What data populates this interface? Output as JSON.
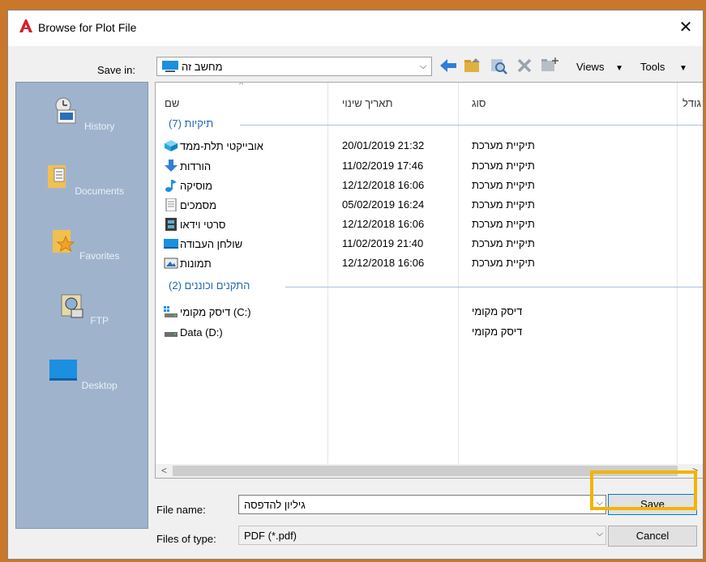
{
  "window": {
    "title": "Browse for Plot File",
    "close_glyph": "✕"
  },
  "savein": {
    "label": "Save in:",
    "value": "מחשב זה"
  },
  "toolbar": {
    "views_label": "Views",
    "tools_label": "Tools"
  },
  "places": [
    {
      "label": "History",
      "icon": "history-icon"
    },
    {
      "label": "Documents",
      "icon": "documents-folder-icon"
    },
    {
      "label": "Favorites",
      "icon": "favorites-folder-icon"
    },
    {
      "label": "FTP",
      "icon": "ftp-icon"
    },
    {
      "label": "Desktop",
      "icon": "desktop-icon"
    }
  ],
  "columns": {
    "name": "שם",
    "date": "תאריך שינוי",
    "type": "סוג",
    "size": "גודל"
  },
  "groups": {
    "folders": "תיקיות (7)",
    "devices": "התקנים וכוננים (2)"
  },
  "folders": [
    {
      "name": "אובייקטי תלת-ממד",
      "date": "20/01/2019 21:32",
      "type": "תיקיית מערכת",
      "icon": "3d-objects-icon"
    },
    {
      "name": "הורדות",
      "date": "11/02/2019 17:46",
      "type": "תיקיית מערכת",
      "icon": "downloads-icon"
    },
    {
      "name": "מוסיקה",
      "date": "12/12/2018 16:06",
      "type": "תיקיית מערכת",
      "icon": "music-icon"
    },
    {
      "name": "מסמכים",
      "date": "05/02/2019 16:24",
      "type": "תיקיית מערכת",
      "icon": "documents-icon"
    },
    {
      "name": "סרטי וידאו",
      "date": "12/12/2018 16:06",
      "type": "תיקיית מערכת",
      "icon": "videos-icon"
    },
    {
      "name": "שולחן העבודה",
      "date": "11/02/2019 21:40",
      "type": "תיקיית מערכת",
      "icon": "desktop-folder-icon"
    },
    {
      "name": "תמונות",
      "date": "12/12/2018 16:06",
      "type": "תיקיית מערכת",
      "icon": "pictures-icon"
    }
  ],
  "drives": [
    {
      "name": "דיסק מקומי (C:)",
      "type": "דיסק מקומי",
      "icon": "system-drive-icon"
    },
    {
      "name": "Data (D:)",
      "type": "דיסק מקומי",
      "icon": "drive-icon"
    }
  ],
  "filename": {
    "label": "File name:",
    "value": "גיליון להדפסה"
  },
  "filetype": {
    "label": "Files of type:",
    "value": "PDF (*.pdf)"
  },
  "buttons": {
    "save": "Save",
    "cancel": "Cancel"
  },
  "colors": {
    "places_bg": "#9fb4cc",
    "group_text": "#1e66b4",
    "highlight": "#f2b400",
    "backdrop": "#c9772b"
  }
}
